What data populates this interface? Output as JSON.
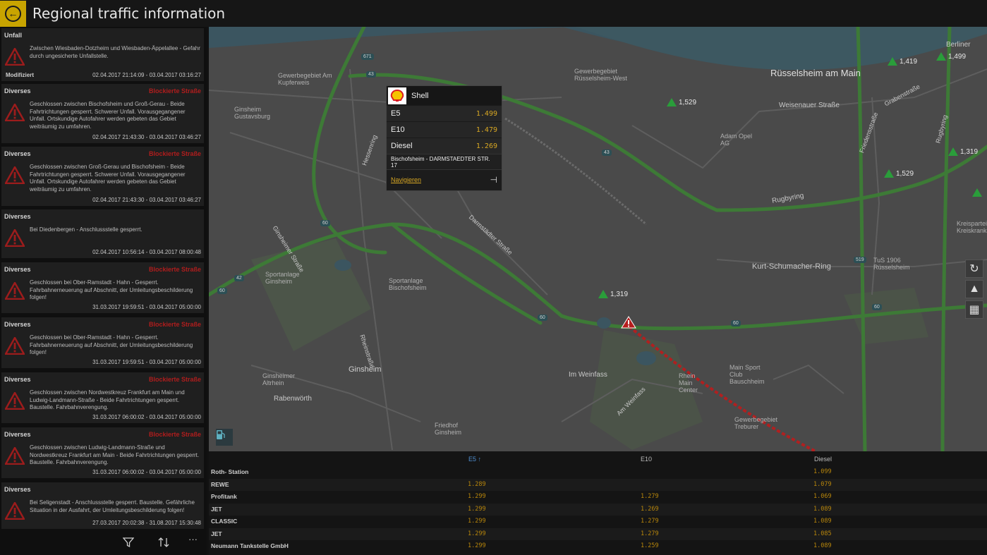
{
  "header": {
    "title": "Regional traffic information",
    "back_icon": "arrow-left-icon"
  },
  "incidents": [
    {
      "category": "Unfall",
      "status": "",
      "description": "Zwischen Wiesbaden-Dotzheim und Wiesbaden-Äppelallee - Gefahr durch ungesicherte Unfallstelle.",
      "modifier": "Modifiziert",
      "time": "02.04.2017 21:14:09 - 03.04.2017 03:16:27"
    },
    {
      "category": "Diverses",
      "status": "Blockierte Straße",
      "description": "Geschlossen zwischen Bischofsheim und Groß-Gerau - Beide Fahrtrichtungen gesperrt. Schwerer Unfall. Vorausgegangener Unfall. Ortskundige Autofahrer werden gebeten das Gebiet weiträumig zu umfahren.",
      "modifier": "",
      "time": "02.04.2017 21:43:30 - 03.04.2017 03:46:27"
    },
    {
      "category": "Diverses",
      "status": "Blockierte Straße",
      "description": "Geschlossen zwischen Groß-Gerau und Bischofsheim - Beide Fahrtrichtungen gesperrt. Schwerer Unfall. Vorausgegangener Unfall. Ortskundige Autofahrer werden gebeten das Gebiet weiträumig zu umfahren.",
      "modifier": "",
      "time": "02.04.2017 21:43:30 - 03.04.2017 03:46:27"
    },
    {
      "category": "Diverses",
      "status": "",
      "description": "Bei Diedenbergen - Anschlussstelle gesperrt.",
      "modifier": "",
      "time": "02.04.2017 10:56:14 - 03.04.2017 08:00:48"
    },
    {
      "category": "Diverses",
      "status": "Blockierte Straße",
      "description": "Geschlossen bei Ober-Ramstadt - Hahn - Gesperrt. Fahrbahnerneuerung auf Abschnitt, der Umleitungsbeschilderung folgen!",
      "modifier": "",
      "time": "31.03.2017 19:59:51 - 03.04.2017 05:00:00"
    },
    {
      "category": "Diverses",
      "status": "Blockierte Straße",
      "description": "Geschlossen bei Ober-Ramstadt - Hahn - Gesperrt. Fahrbahnerneuerung auf Abschnitt, der Umleitungsbeschilderung folgen!",
      "modifier": "",
      "time": "31.03.2017 19:59:51 - 03.04.2017 05:00:00"
    },
    {
      "category": "Diverses",
      "status": "Blockierte Straße",
      "description": "Geschlossen zwischen Nordwestkreuz Frankfurt am Main und Ludwig-Landmann-Straße - Beide Fahrtrichtungen gesperrt. Baustelle. Fahrbahnverengung.",
      "modifier": "",
      "time": "31.03.2017 06:00:02 - 03.04.2017 05:00:00"
    },
    {
      "category": "Diverses",
      "status": "Blockierte Straße",
      "description": "Geschlossen zwischen Ludwig-Landmann-Straße und Nordwestkreuz Frankfurt am Main - Beide Fahrtrichtungen gesperrt. Baustelle. Fahrbahnverengung.",
      "modifier": "",
      "time": "31.03.2017 06:00:02 - 03.04.2017 05:00:00"
    },
    {
      "category": "Diverses",
      "status": "",
      "description": "Bei Seligenstadt - Anschlussstelle gesperrt. Baustelle. Gefährliche Situation in der Ausfahrt, der Umleitungsbeschilderung folgen!",
      "modifier": "",
      "time": "27.03.2017 20:02:38 - 31.08.2017 15:30:48"
    }
  ],
  "left_toolbar": {
    "filter_icon": "filter-icon",
    "sort_icon": "sort-icon",
    "more_label": "···"
  },
  "map": {
    "labels": {
      "ruesselsheim": "Rüsselsheim am Main",
      "ginsheim": "Ginsheim",
      "rabenwoerth": "Rabenwörth",
      "im_weinfass": "Im Weinfass",
      "berliner": "Berliner",
      "gewerbe1": "Gewerbegebiet Rüsselsheim-West",
      "gewerbe2": "Gewerbegebiet Treburer",
      "adam_opel": "Adam Opel AG",
      "friedhof": "Friedhof Ginsheim",
      "sportanlage1": "Sportanlage Ginsheim",
      "sportanlage2": "Sportanlage Bischofsheim",
      "tus": "TuS 1906 Rüsselsheim",
      "kreis": "Kreisparteisamt Kreiskrankenhaus",
      "main_sport": "Main Sport Club Bauschheim",
      "rhein_main": "Rhein Main Center",
      "ginsheimer_altrhein": "Ginsheimer Altrhein",
      "ginsheim_gustavsburg": "Ginsheim Gustavsburg",
      "gewerbe_top": "Gewerbegebiet Am Kupferweis"
    },
    "roads": {
      "kurt": "Kurt-Schumacher-Ring",
      "rugbyring": "Rugbyring",
      "weisenauer": "Weisenauer Straße",
      "grabenstrasse": "Grabenstraße",
      "darmstaedter": "Darmstädter Straße",
      "ginsheimer": "Ginsheimer Straße",
      "rheinstrasse": "Rheinstraße",
      "am_weinfass": "Am Weinfass",
      "hessenring": "Hessenring",
      "friedensstrasse": "Friedensstraße",
      "rugbyring2": "Rugbyring"
    },
    "shields": [
      "671",
      "43",
      "60",
      "42",
      "60",
      "60",
      "60",
      "519",
      "60",
      "43"
    ],
    "price_markers": [
      "1,419",
      "1,499",
      "1,529",
      "1,319",
      "1,529",
      "1,319"
    ],
    "buttons": {
      "refresh": "refresh-icon",
      "north": "north-arrow-icon",
      "layers": "layers-icon",
      "fuel": "fuel-station-icon"
    }
  },
  "popup": {
    "brand": "Shell",
    "rows": [
      {
        "label": "E5",
        "value": "1.499"
      },
      {
        "label": "E10",
        "value": "1.479"
      },
      {
        "label": "Diesel",
        "value": "1.269"
      }
    ],
    "address": "Bischofsheim - DARMSTAEDTER STR. 17",
    "navigate": "Navigieren"
  },
  "table": {
    "headers": {
      "e5": "E5 ↑",
      "e10": "E10",
      "diesel": "Diesel"
    },
    "rows": [
      {
        "name": "Roth- Station",
        "e5": "",
        "e10": "",
        "diesel": "1.099"
      },
      {
        "name": "REWE",
        "e5": "1.289",
        "e10": "",
        "diesel": "1.079"
      },
      {
        "name": "Profitank",
        "e5": "1.299",
        "e10": "1.279",
        "diesel": "1.069"
      },
      {
        "name": "JET",
        "e5": "1.299",
        "e10": "1.269",
        "diesel": "1.089"
      },
      {
        "name": "CLASSIC",
        "e5": "1.299",
        "e10": "1.279",
        "diesel": "1.089"
      },
      {
        "name": "JET",
        "e5": "1.299",
        "e10": "1.279",
        "diesel": "1.085"
      },
      {
        "name": "Neumann Tankstelle GmbH",
        "e5": "1.299",
        "e10": "1.259",
        "diesel": "1.089"
      }
    ]
  },
  "colors": {
    "accent": "#c8a400",
    "blocked": "#b01d1d",
    "price": "#d9a823",
    "map_road": "#3d7a36",
    "sort_header": "#4f8fd1"
  }
}
